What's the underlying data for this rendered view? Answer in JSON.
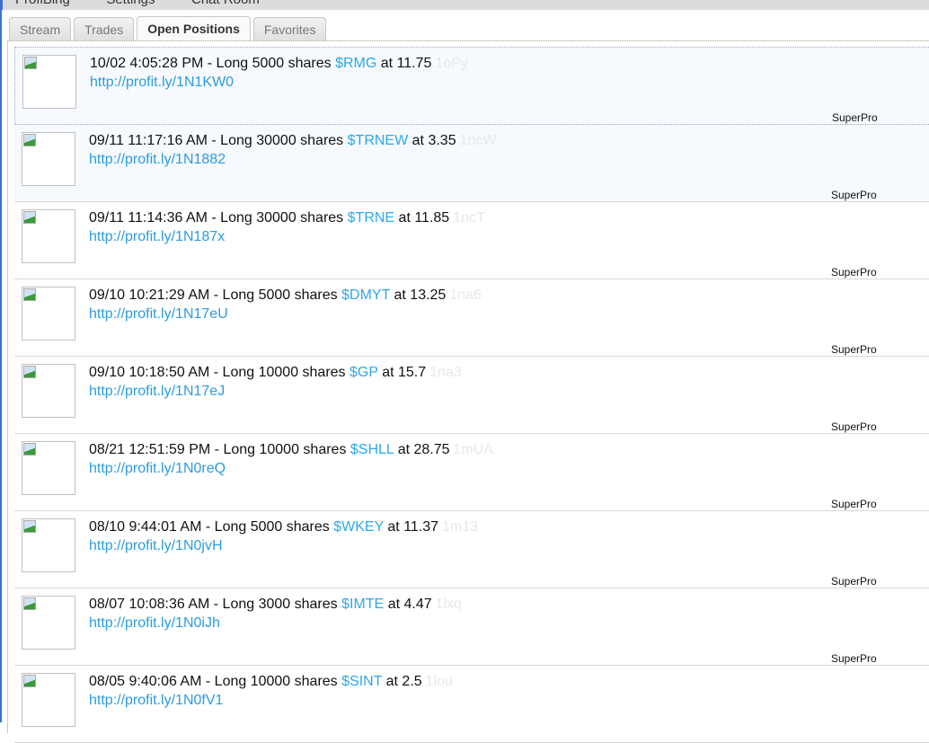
{
  "menu": [
    "ProfiBing",
    "Settings",
    "Chat Room"
  ],
  "tabs": [
    {
      "label": "Stream"
    },
    {
      "label": "Trades"
    },
    {
      "label": "Open Positions"
    },
    {
      "label": "Favorites"
    }
  ],
  "positions": [
    {
      "time": "10/02 4:05:28 PM",
      "text": "- Long 5000 shares",
      "ticker": "$RMG",
      "price": "at 11.75",
      "code": "1oPy",
      "link": "http://profit.ly/1N1KW0",
      "badge": "SuperPro"
    },
    {
      "time": "09/11 11:17:16 AM",
      "text": "- Long 30000 shares",
      "ticker": "$TRNEW",
      "price": "at 3.35",
      "code": "1ncW",
      "link": "http://profit.ly/1N1882",
      "badge": "SuperPro"
    },
    {
      "time": "09/11 11:14:36 AM",
      "text": "- Long 30000 shares",
      "ticker": "$TRNE",
      "price": "at 11.85",
      "code": "1ncT",
      "link": "http://profit.ly/1N187x",
      "badge": "SuperPro"
    },
    {
      "time": "09/10 10:21:29 AM",
      "text": "- Long 5000 shares",
      "ticker": "$DMYT",
      "price": "at 13.25",
      "code": "1na6",
      "link": "http://profit.ly/1N17eU",
      "badge": "SuperPro"
    },
    {
      "time": "09/10 10:18:50 AM",
      "text": "- Long 10000 shares",
      "ticker": "$GP",
      "price": "at 15.7",
      "code": "1na3",
      "link": "http://profit.ly/1N17eJ",
      "badge": "SuperPro"
    },
    {
      "time": "08/21 12:51:59 PM",
      "text": "- Long 10000 shares",
      "ticker": "$SHLL",
      "price": "at 28.75",
      "code": "1mUA",
      "link": "http://profit.ly/1N0reQ",
      "badge": "SuperPro"
    },
    {
      "time": "08/10 9:44:01 AM",
      "text": "- Long 5000 shares",
      "ticker": "$WKEY",
      "price": "at 11.37",
      "code": "1m13",
      "link": "http://profit.ly/1N0jvH",
      "badge": "SuperPro"
    },
    {
      "time": "08/07 10:08:36 AM",
      "text": "- Long 3000 shares",
      "ticker": "$IMTE",
      "price": "at 4.47",
      "code": "1lxq",
      "link": "http://profit.ly/1N0iJh",
      "badge": "SuperPro"
    },
    {
      "time": "08/05 9:40:06 AM",
      "text": "- Long 10000 shares",
      "ticker": "$SINT",
      "price": "at 2.5",
      "code": "1lou",
      "link": "http://profit.ly/1N0fV1",
      "badge": ""
    }
  ]
}
